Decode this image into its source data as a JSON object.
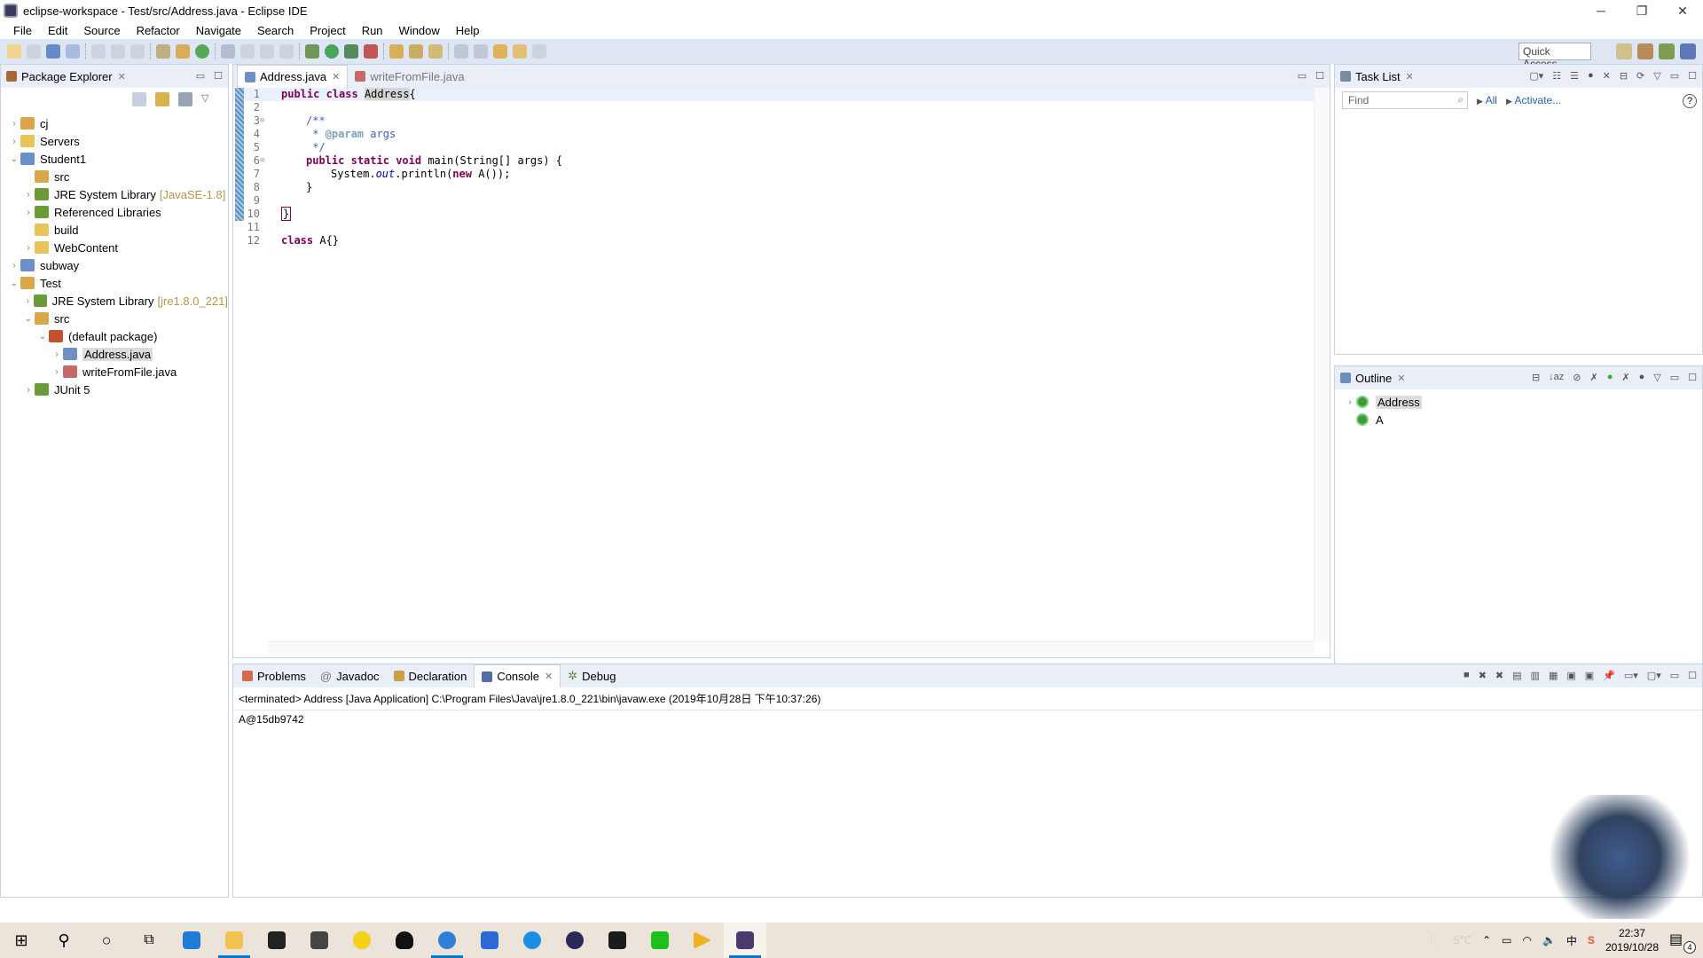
{
  "window": {
    "title": "eclipse-workspace - Test/src/Address.java - Eclipse IDE",
    "controls": [
      "minimize",
      "restore",
      "close"
    ]
  },
  "menu": [
    "File",
    "Edit",
    "Source",
    "Refactor",
    "Navigate",
    "Search",
    "Project",
    "Run",
    "Window",
    "Help"
  ],
  "toolbar": {
    "quick_access": "Quick Access"
  },
  "package_explorer": {
    "title": "Package Explorer",
    "tree": [
      {
        "label": "cj",
        "level": 0,
        "state": "collapsed",
        "icon": "project-error-icon"
      },
      {
        "label": "Servers",
        "level": 0,
        "state": "collapsed",
        "icon": "folder-icon"
      },
      {
        "label": "Student1",
        "level": 0,
        "state": "expanded",
        "icon": "web-project-warning-icon"
      },
      {
        "label": "src",
        "level": 1,
        "state": "none",
        "icon": "source-folder-icon"
      },
      {
        "label": "JRE System Library",
        "decoration": "[JavaSE-1.8]",
        "level": 1,
        "state": "collapsed",
        "icon": "library-icon"
      },
      {
        "label": "Referenced Libraries",
        "level": 1,
        "state": "collapsed",
        "icon": "library-icon"
      },
      {
        "label": "build",
        "level": 1,
        "state": "none",
        "icon": "folder-icon"
      },
      {
        "label": "WebContent",
        "level": 1,
        "state": "collapsed",
        "icon": "folder-icon"
      },
      {
        "label": "subway",
        "level": 0,
        "state": "collapsed",
        "icon": "project-icon"
      },
      {
        "label": "Test",
        "level": 0,
        "state": "expanded",
        "icon": "project-error-icon"
      },
      {
        "label": "JRE System Library",
        "decoration": "[jre1.8.0_221]",
        "level": 1,
        "state": "collapsed",
        "icon": "library-icon"
      },
      {
        "label": "src",
        "level": 1,
        "state": "expanded",
        "icon": "source-folder-error-icon"
      },
      {
        "label": "(default package)",
        "level": 2,
        "state": "expanded",
        "icon": "package-error-icon"
      },
      {
        "label": "Address.java",
        "level": 3,
        "state": "collapsed",
        "icon": "java-file-icon",
        "selected": true
      },
      {
        "label": "writeFromFile.java",
        "level": 3,
        "state": "collapsed",
        "icon": "java-file-error-icon"
      },
      {
        "label": "JUnit 5",
        "level": 1,
        "state": "collapsed",
        "icon": "library-icon"
      }
    ]
  },
  "editor": {
    "tabs": [
      {
        "label": "Address.java",
        "active": true
      },
      {
        "label": "writeFromFile.java",
        "active": false
      }
    ],
    "lines": [
      {
        "n": "1",
        "fold": ""
      },
      {
        "n": "2",
        "fold": ""
      },
      {
        "n": "3",
        "fold": "⊖"
      },
      {
        "n": "4",
        "fold": ""
      },
      {
        "n": "5",
        "fold": ""
      },
      {
        "n": "6",
        "fold": "⊖"
      },
      {
        "n": "7",
        "fold": ""
      },
      {
        "n": "8",
        "fold": ""
      },
      {
        "n": "9",
        "fold": ""
      },
      {
        "n": "10",
        "fold": ""
      },
      {
        "n": "11",
        "fold": ""
      },
      {
        "n": "12",
        "fold": ""
      }
    ],
    "code": {
      "l1_kw1": "public",
      "l1_kw2": "class",
      "l1_name": "Address",
      "l1_rest": "{",
      "l3": "/**",
      "l4_star": " * ",
      "l4_tag": "@param",
      "l4_arg": " args",
      "l5": " */",
      "l6_kw1": "public",
      "l6_kw2": "static",
      "l6_kw3": "void",
      "l6_rest": " main(String[] args) {",
      "l7_a": "System.",
      "l7_fld": "out",
      "l7_b": ".println(",
      "l7_kw": "new",
      "l7_c": " A());",
      "l8": "}",
      "l10": "}",
      "l12_kw": "class",
      "l12_rest": " A{}"
    }
  },
  "task_list": {
    "title": "Task List",
    "find_placeholder": "Find",
    "all_label": "All",
    "activate_label": "Activate..."
  },
  "outline": {
    "title": "Outline",
    "items": [
      {
        "label": "Address",
        "selected": true
      },
      {
        "label": "A"
      }
    ]
  },
  "bottom_panel": {
    "tabs": [
      {
        "label": "Problems",
        "active": false
      },
      {
        "label": "Javadoc",
        "active": false
      },
      {
        "label": "Declaration",
        "active": false
      },
      {
        "label": "Console",
        "active": true
      },
      {
        "label": "Debug",
        "active": false
      }
    ],
    "console_description": "<terminated> Address [Java Application] C:\\Program Files\\Java\\jre1.8.0_221\\bin\\javaw.exe (2019年10月28日 下午10:37:26)",
    "console_output": "A@15db9742"
  },
  "taskbar": {
    "apps": [
      "start",
      "search",
      "cortana",
      "task-view",
      "edge",
      "file-explorer",
      "store",
      "mail",
      "qq-music",
      "qq",
      "sogou-browser",
      "wps",
      "uplay",
      "eclipse",
      "green-app",
      "iqiyi",
      "video-player",
      "active-app"
    ],
    "weather": "5℃",
    "ime": "中",
    "time": "22:37",
    "date": "2019/10/28",
    "notifications": "4"
  }
}
